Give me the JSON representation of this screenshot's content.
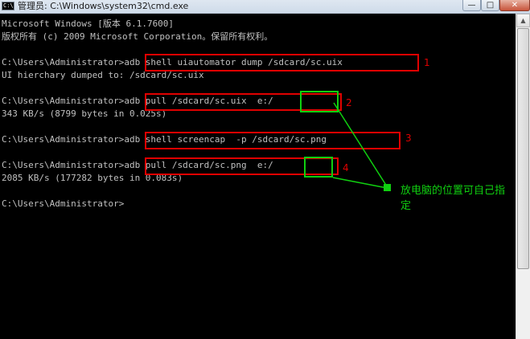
{
  "window": {
    "title": "管理员: C:\\Windows\\system32\\cmd.exe",
    "app_icon_text": "C:\\",
    "minimize": "—",
    "maximize": "□",
    "close": "✕"
  },
  "console": {
    "lines": [
      "Microsoft Windows [版本 6.1.7600]",
      "版权所有 (c) 2009 Microsoft Corporation。保留所有权利。",
      "",
      "C:\\Users\\Administrator>adb shell uiautomator dump /sdcard/sc.uix",
      "UI hierchary dumped to: /sdcard/sc.uix",
      "",
      "C:\\Users\\Administrator>adb pull /sdcard/sc.uix  e:/",
      "343 KB/s (8799 bytes in 0.025s)",
      "",
      "C:\\Users\\Administrator>adb shell screencap  -p /sdcard/sc.png",
      "",
      "C:\\Users\\Administrator>adb pull /sdcard/sc.png  e:/",
      "2085 KB/s (177282 bytes in 0.083s)",
      "",
      "C:\\Users\\Administrator>"
    ]
  },
  "annotations": {
    "steps": [
      "1",
      "2",
      "3",
      "4"
    ],
    "note": "放电脑的位置可自己指定",
    "red_color": "#e00000",
    "green_color": "#10d010"
  }
}
